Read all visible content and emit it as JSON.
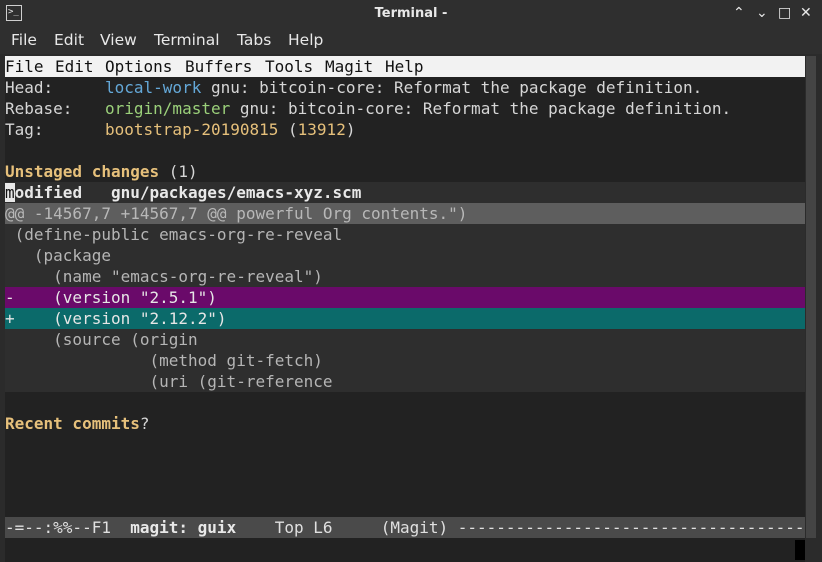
{
  "window": {
    "title": "Terminal -",
    "app_icon_glyph": ">_"
  },
  "window_controls": {
    "minimize": "⌃",
    "restore": "⌄",
    "maximize": "□",
    "close": "✕"
  },
  "menubar": {
    "items": [
      "File",
      "Edit",
      "View",
      "Terminal",
      "Tabs",
      "Help"
    ]
  },
  "emacs": {
    "menu": [
      "File",
      "Edit",
      "Options",
      "Buffers",
      "Tools",
      "Magit",
      "Help"
    ],
    "head": {
      "label": "Head:",
      "branch": "local-work",
      "text": " gnu: bitcoin-core: Reformat the package definition."
    },
    "rebase": {
      "label": "Rebase:",
      "branch": "origin/master",
      "text": " gnu: bitcoin-core: Reformat the package definition."
    },
    "tag": {
      "label": "Tag:",
      "name": "bootstrap-20190815",
      "count_open": " (",
      "count": "13912",
      "count_close": ")"
    },
    "unstaged": {
      "title": "Unstaged changes",
      "count": " (1)"
    },
    "file": {
      "cursor_char": "m",
      "status_rest": "odified",
      "path": "   gnu/packages/emacs-xyz.scm"
    },
    "diff": [
      {
        "kind": "hunk",
        "text": "@@ -14567,7 +14567,7 @@ powerful Org contents.\")"
      },
      {
        "kind": "ctx",
        "text": " (define-public emacs-org-re-reveal"
      },
      {
        "kind": "ctx",
        "text": "   (package"
      },
      {
        "kind": "ctx",
        "text": "     (name \"emacs-org-re-reveal\")"
      },
      {
        "kind": "del",
        "text": "-    (version \"2.5.1\")"
      },
      {
        "kind": "add",
        "text": "+    (version \"2.12.2\")"
      },
      {
        "kind": "ctx",
        "text": "     (source (origin"
      },
      {
        "kind": "ctx",
        "text": "               (method git-fetch)"
      },
      {
        "kind": "ctx",
        "text": "               (uri (git-reference"
      }
    ],
    "recent": {
      "title": "Recent commits",
      "suffix": "?"
    },
    "modeline": {
      "prefix": "-=--:%%--F1  ",
      "buffer": "magit: guix",
      "rest": "    Top L6     (Magit) -------------------------------------"
    }
  },
  "colors": {
    "branch": "#64a8d8",
    "remote_branch": "#9bd07a",
    "tag": "#e6c07b",
    "section_heading": "#e6c07b",
    "diff_removed_bg": "#6a0a6a",
    "diff_added_bg": "#0b6a6a",
    "hunk_header_bg": "#5e5e5e"
  }
}
